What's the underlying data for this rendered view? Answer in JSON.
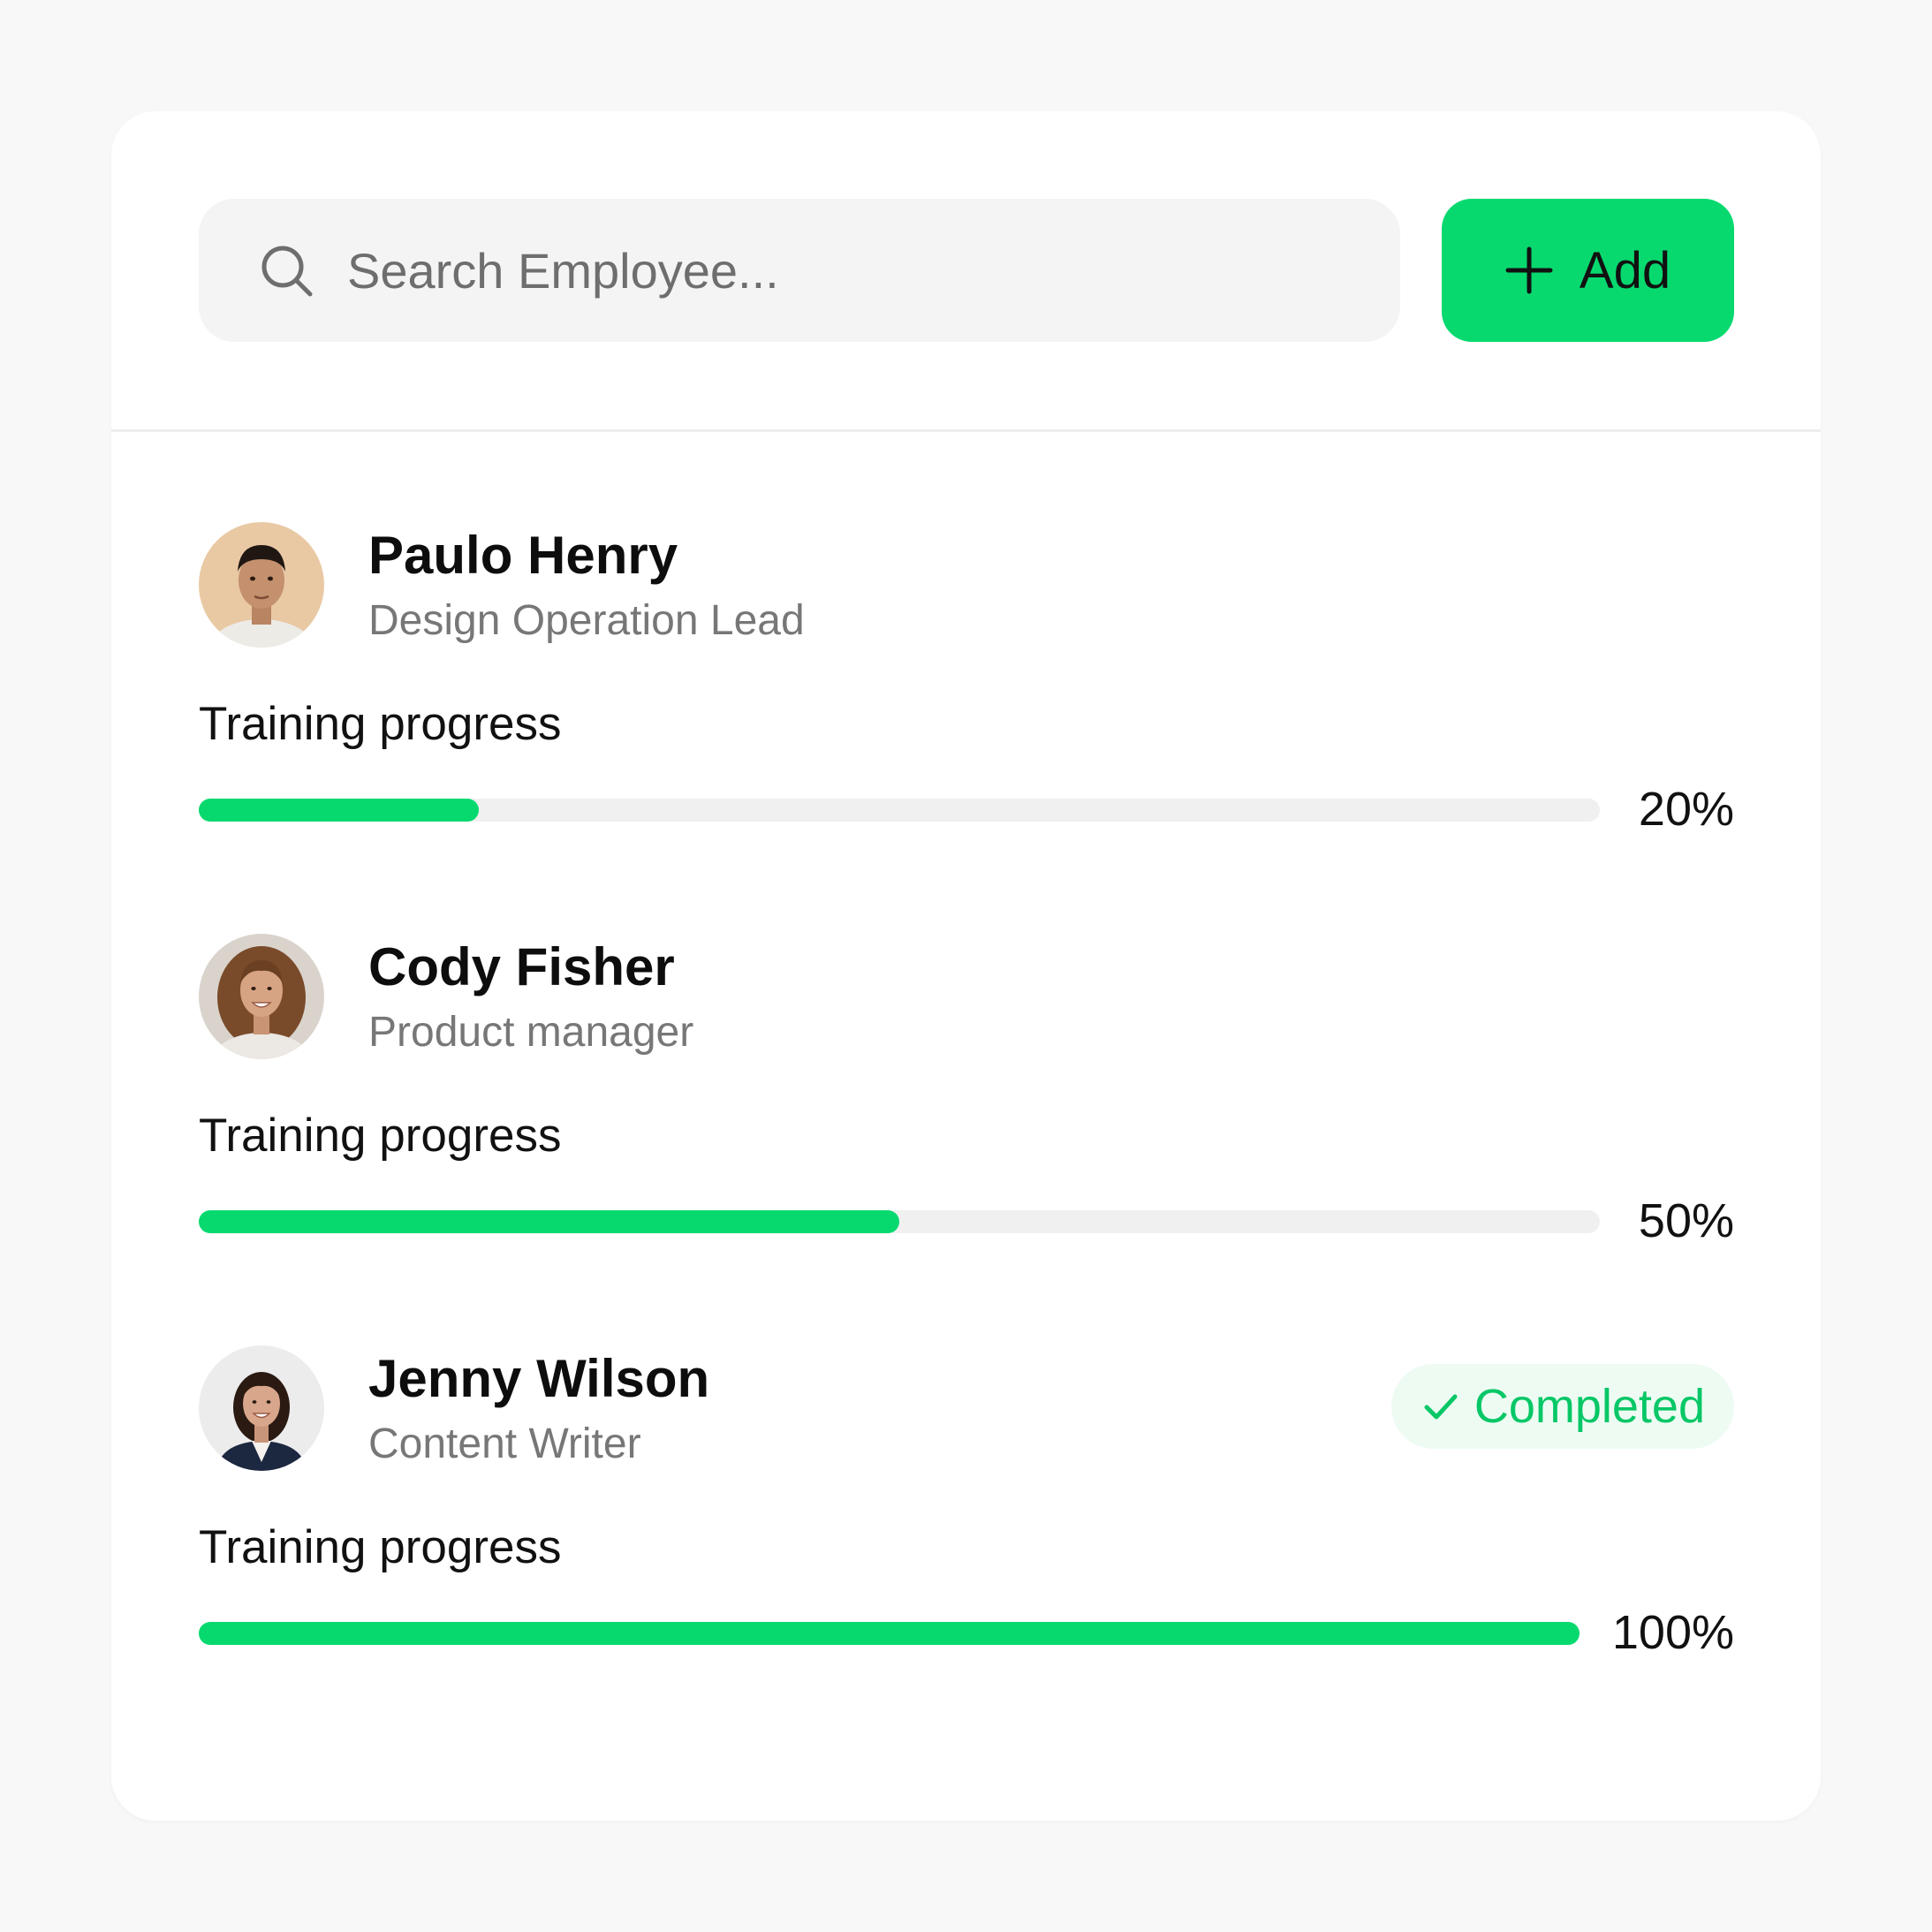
{
  "search": {
    "placeholder": "Search Employee...",
    "icon": "search-icon"
  },
  "add_button": {
    "label": "Add",
    "icon": "plus-icon"
  },
  "colors": {
    "accent": "#07d96f",
    "track": "#f0f0f0",
    "badge_bg": "#edfbf3",
    "badge_text": "#07c766"
  },
  "employees": [
    {
      "name": "Paulo Henry",
      "role": "Design Operation Lead",
      "progress_label": "Training progress",
      "progress_value": 20,
      "progress_text": "20%",
      "status": ""
    },
    {
      "name": "Cody Fisher",
      "role": "Product manager",
      "progress_label": "Training progress",
      "progress_value": 50,
      "progress_text": "50%",
      "status": ""
    },
    {
      "name": "Jenny Wilson",
      "role": "Content Writer",
      "progress_label": "Training progress",
      "progress_value": 100,
      "progress_text": "100%",
      "status": "Completed",
      "status_icon": "check-icon"
    }
  ]
}
